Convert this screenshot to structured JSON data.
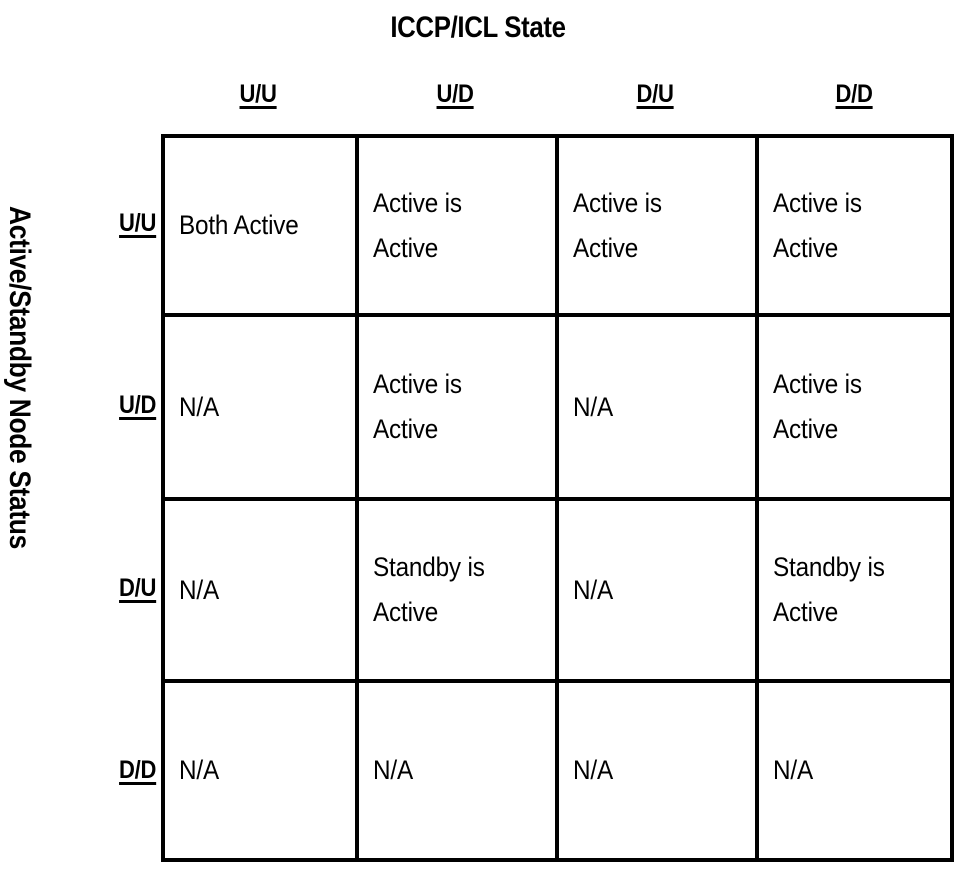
{
  "title": "ICCP/ICL State",
  "axis_labels": {
    "top": "ICCP/ICL State",
    "left": "Active/Standby Node Status"
  },
  "columns": [
    {
      "label": "U/U"
    },
    {
      "label": "U/D"
    },
    {
      "label": "D/U"
    },
    {
      "label": "D/D"
    }
  ],
  "rows": [
    {
      "label": "U/U"
    },
    {
      "label": "U/D"
    },
    {
      "label": "D/U"
    },
    {
      "label": "D/D"
    }
  ],
  "cells": [
    [
      "Both Active",
      "Active is Active",
      "Active is Active",
      "Active is Active"
    ],
    [
      "N/A",
      "Active is Active",
      "N/A",
      "Active is Active"
    ],
    [
      "N/A",
      "Standby is Active",
      "N/A",
      "Standby is Active"
    ],
    [
      "N/A",
      "N/A",
      "N/A",
      "N/A"
    ]
  ],
  "chart_data": {
    "type": "table",
    "title": "ICCP/ICL State",
    "xlabel": "ICCP/ICL State",
    "ylabel": "Active/Standby Node Status",
    "categories": [
      "U/U",
      "U/D",
      "D/U",
      "D/D"
    ],
    "row_categories": [
      "U/U",
      "U/D",
      "D/U",
      "D/D"
    ],
    "values": [
      [
        "Both Active",
        "Active is Active",
        "Active is Active",
        "Active is Active"
      ],
      [
        "N/A",
        "Active is Active",
        "N/A",
        "Active is Active"
      ],
      [
        "N/A",
        "Standby is Active",
        "N/A",
        "Standby is Active"
      ],
      [
        "N/A",
        "N/A",
        "N/A",
        "N/A"
      ]
    ]
  },
  "colors": {
    "border": "#000000",
    "text": "#000000",
    "background": "#ffffff"
  }
}
